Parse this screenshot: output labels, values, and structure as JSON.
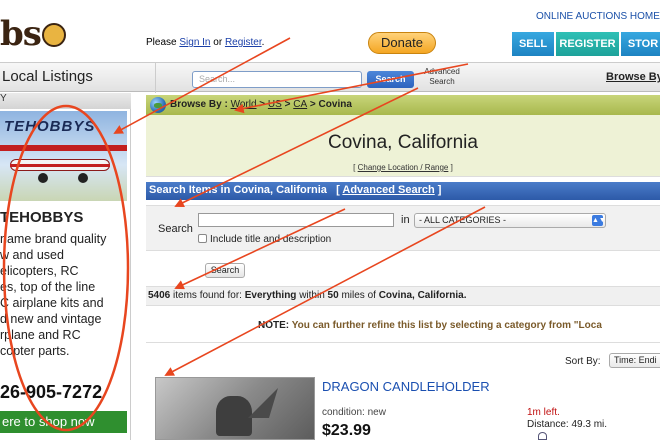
{
  "header": {
    "logo_text": "bsStore",
    "signin_prefix": "Please ",
    "signin_link": "Sign In",
    "signin_or": " or ",
    "register_link": "Register",
    "signin_suffix": ".",
    "donate": "Donate",
    "toplinks": "ONLINE AUCTIONS HOME I",
    "nav": {
      "sell": "SELL",
      "register": "REGISTER",
      "store": "STOR"
    }
  },
  "bar": {
    "title": "Local Listings",
    "search_placeholder": "Search...",
    "search_button": "Search",
    "advanced_line1": "Advanced",
    "advanced_line2": "Search",
    "browse": "Browse By"
  },
  "sidebar": {
    "head": "Y",
    "ad_image_text": "TEHOBBYS",
    "ad_title": "TEHOBBYS",
    "ad_text": "name brand quality\nw and used\nelicopters, RC\nes, top of the line\nC airplane kits and\nd new and vintage\nrplane and RC\ncopter parts.",
    "phone": "26-905-7272",
    "shop_button": "ere to shop now"
  },
  "crumb": {
    "label": "Browse By : ",
    "world": "World",
    "us": "US",
    "ca": "CA",
    "sep": " > ",
    "city": "Covina"
  },
  "location": {
    "title": "Covina, California",
    "change_open": "[ ",
    "change_link": "Change Location / Range",
    "change_close": " ]"
  },
  "search": {
    "heading": "Search Items in Covina, California",
    "adv_open": "[ ",
    "adv_link": "Advanced Search",
    "adv_close": " ]",
    "label": "Search",
    "in_text": "in",
    "category": "- ALL CATEGORIES -",
    "checkbox_label": "Include title and description",
    "button": "Search"
  },
  "results": {
    "count": "5406",
    "text1": " items found for: ",
    "query": "Everything",
    "text2": " within ",
    "radius": "50",
    "text3": " miles of ",
    "place": "Covina, California.",
    "note_label": "NOTE:",
    "note_text": " You can further refine this list by selecting a category from \"Loca",
    "sort_label": "Sort By:",
    "sort_value": "Time: Endi"
  },
  "item": {
    "title": "DRAGON CANDLEHOLDER",
    "condition": "condition: new",
    "price": "$23.99",
    "time_left": "1m left.",
    "distance": "Distance: 49.3 mi."
  },
  "colors": {
    "annotation": "#e8461f",
    "nav_blue": "#2a8fd0",
    "nav_teal": "#22aaa1",
    "crumb_green": "#b4c35a",
    "search_bar_blue": "#3a6bbf"
  }
}
